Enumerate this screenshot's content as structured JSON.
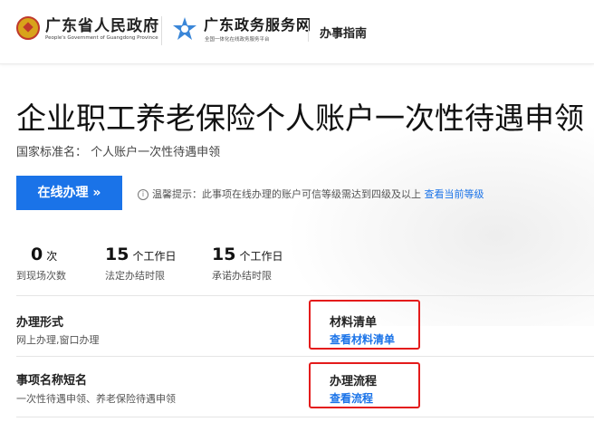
{
  "header": {
    "gov_title": "广东省人民政府",
    "gov_subtitle": "People's Government of Guangdong Province",
    "svc_title": "广东政务服务网",
    "svc_subtitle": "全国一体化在线政务服务平台",
    "guide_label": "办事指南"
  },
  "main": {
    "title": "企业职工养老保险个人账户一次性待遇申领",
    "standard_name": "国家标准名：  个人账户一次性待遇申领",
    "online_button": "在线办理 »",
    "tip_icon": "i",
    "tip_text": "温馨提示：此事项在线办理的账户可信等级需达到四级及以上",
    "tip_link": "查看当前等级"
  },
  "stats": [
    {
      "num": "0",
      "unit": "次",
      "label": "到现场次数"
    },
    {
      "num": "15",
      "unit": "个工作日",
      "label": "法定办结时限"
    },
    {
      "num": "15",
      "unit": "个工作日",
      "label": "承诺办结时限"
    }
  ],
  "info": {
    "form_label": "办理形式",
    "form_value": "网上办理,窗口办理",
    "materials_label": "材料清单",
    "materials_link": "查看材料清单",
    "short_name_label": "事项名称短名",
    "short_name_value": "一次性待遇申领、养老保险待遇申领",
    "process_label": "办理流程",
    "process_link": "查看流程"
  },
  "colors": {
    "primary": "#1a73e8",
    "highlight_box": "#e41b1b"
  }
}
